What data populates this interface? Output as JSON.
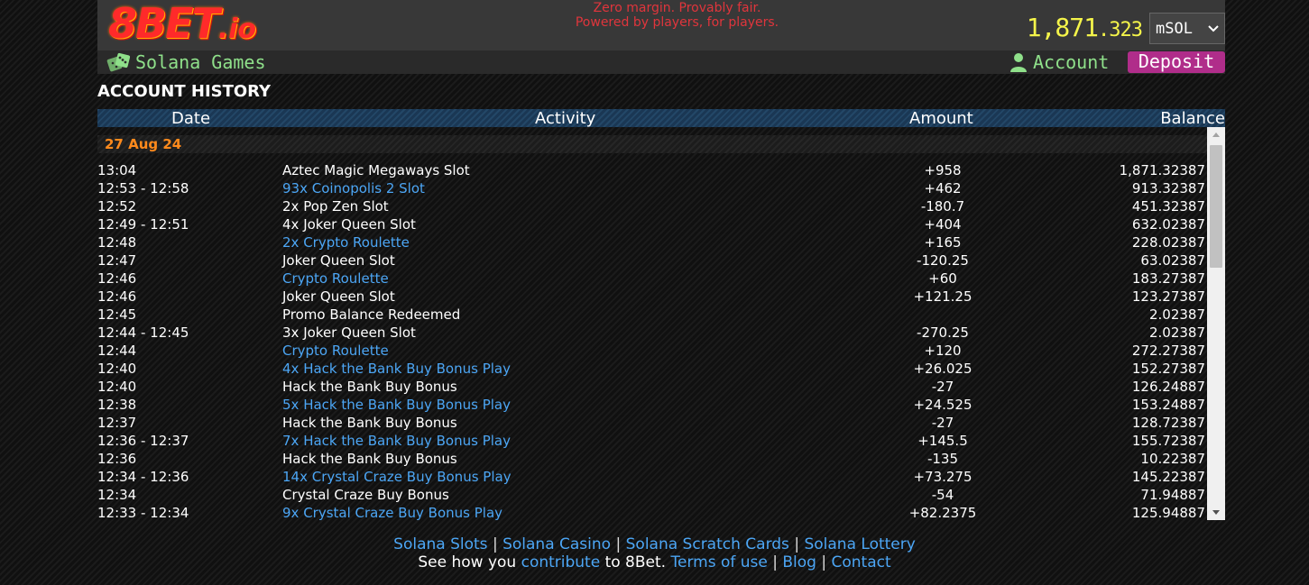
{
  "header": {
    "logo": {
      "main": "8BET",
      "suffix": ".io"
    },
    "subtitle": "Solana Games",
    "tagline": [
      "Zero margin. Provably fair.",
      "Powered by players, for players."
    ],
    "balance": {
      "whole": "1,871",
      "fraction": ".323"
    },
    "currency": {
      "selected": "mSOL"
    },
    "account_label": "Account",
    "deposit_label": "Deposit",
    "colors": {
      "tagline": "#e0353c",
      "balance": "#f4f44a",
      "account": "#8fe08a",
      "deposit": "#b02d8a"
    }
  },
  "page_title": "ACCOUNT HISTORY",
  "table": {
    "headers": {
      "date": "Date",
      "activity": "Activity",
      "amount": "Amount",
      "balance": "Balance"
    },
    "date_group": "27 Aug 24",
    "rows": [
      {
        "date": "13:04",
        "activity": "Aztec Magic Megaways Slot",
        "link": false,
        "amount": "+958",
        "balance": "1,871.32387"
      },
      {
        "date": "12:53 - 12:58",
        "activity": "93x Coinopolis 2 Slot",
        "link": true,
        "amount": "+462",
        "balance": "913.32387"
      },
      {
        "date": "12:52",
        "activity": "2x Pop Zen Slot",
        "link": false,
        "amount": "-180.7",
        "balance": "451.32387"
      },
      {
        "date": "12:49 - 12:51",
        "activity": "4x Joker Queen Slot",
        "link": false,
        "amount": "+404",
        "balance": "632.02387"
      },
      {
        "date": "12:48",
        "activity": "2x Crypto Roulette",
        "link": true,
        "amount": "+165",
        "balance": "228.02387"
      },
      {
        "date": "12:47",
        "activity": "Joker Queen Slot",
        "link": false,
        "amount": "-120.25",
        "balance": "63.02387"
      },
      {
        "date": "12:46",
        "activity": "Crypto Roulette",
        "link": true,
        "amount": "+60",
        "balance": "183.27387"
      },
      {
        "date": "12:46",
        "activity": "Joker Queen Slot",
        "link": false,
        "amount": "+121.25",
        "balance": "123.27387"
      },
      {
        "date": "12:45",
        "activity": "Promo Balance Redeemed",
        "link": false,
        "amount": "",
        "balance": "2.02387"
      },
      {
        "date": "12:44 - 12:45",
        "activity": "3x Joker Queen Slot",
        "link": false,
        "amount": "-270.25",
        "balance": "2.02387"
      },
      {
        "date": "12:44",
        "activity": "Crypto Roulette",
        "link": true,
        "amount": "+120",
        "balance": "272.27387"
      },
      {
        "date": "12:40",
        "activity": "4x Hack the Bank Buy Bonus Play",
        "link": true,
        "amount": "+26.025",
        "balance": "152.27387"
      },
      {
        "date": "12:40",
        "activity": "Hack the Bank Buy Bonus",
        "link": false,
        "amount": "-27",
        "balance": "126.24887"
      },
      {
        "date": "12:38",
        "activity": "5x Hack the Bank Buy Bonus Play",
        "link": true,
        "amount": "+24.525",
        "balance": "153.24887"
      },
      {
        "date": "12:37",
        "activity": "Hack the Bank Buy Bonus",
        "link": false,
        "amount": "-27",
        "balance": "128.72387"
      },
      {
        "date": "12:36 - 12:37",
        "activity": "7x Hack the Bank Buy Bonus Play",
        "link": true,
        "amount": "+145.5",
        "balance": "155.72387"
      },
      {
        "date": "12:36",
        "activity": "Hack the Bank Buy Bonus",
        "link": false,
        "amount": "-135",
        "balance": "10.22387"
      },
      {
        "date": "12:34 - 12:36",
        "activity": "14x Crystal Craze Buy Bonus Play",
        "link": true,
        "amount": "+73.275",
        "balance": "145.22387"
      },
      {
        "date": "12:34",
        "activity": "Crystal Craze Buy Bonus",
        "link": false,
        "amount": "-54",
        "balance": "71.94887"
      },
      {
        "date": "12:33 - 12:34",
        "activity": "9x Crystal Craze Buy Bonus Play",
        "link": true,
        "amount": "+82.2375",
        "balance": "125.94887"
      }
    ],
    "colors": {
      "link": "#4ca6f5",
      "date_group": "#ff8a1c"
    }
  },
  "footer": {
    "links_row1": [
      "Solana Slots",
      "Solana Casino",
      "Solana Scratch Cards",
      "Solana Lottery"
    ],
    "row2": {
      "prefix": "See how you ",
      "contribute": "contribute",
      "middle": " to 8Bet. ",
      "terms": "Terms of use",
      "blog": "Blog",
      "contact": "Contact"
    },
    "separator": "|"
  },
  "icons": [
    "dice-icon",
    "user-icon",
    "chevron-down-icon",
    "scroll-up-arrow-icon",
    "scroll-down-arrow-icon"
  ]
}
